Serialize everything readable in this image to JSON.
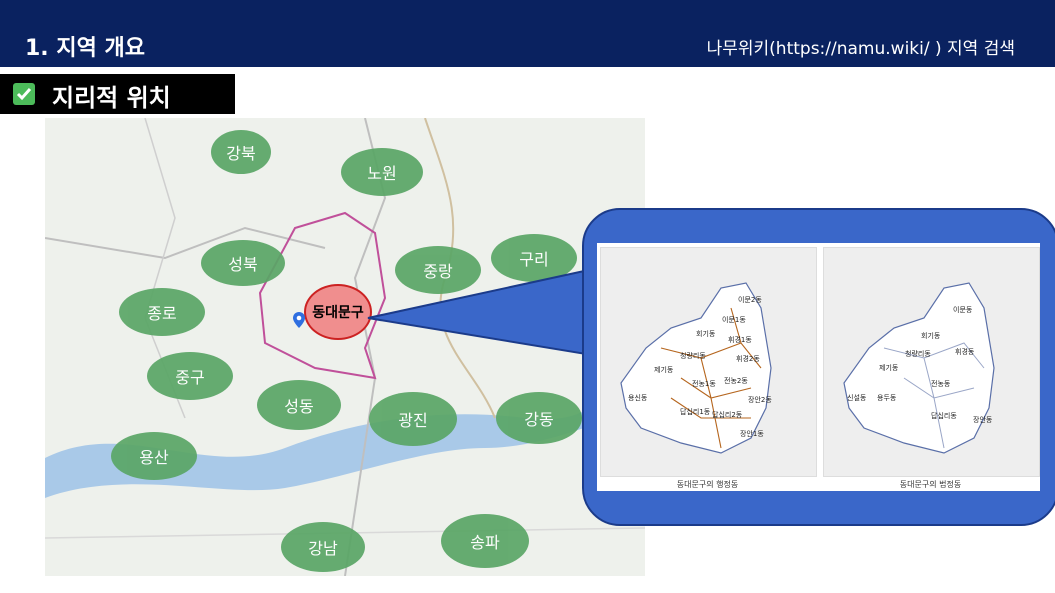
{
  "header": {
    "title": "1. 지역 개요",
    "source": "나무위키(https://namu.wiki/ ) 지역 검색"
  },
  "section": {
    "title": "지리적 위치"
  },
  "map": {
    "districts": {
      "gangbuk": "강북",
      "nowon": "노원",
      "seongbuk": "성북",
      "jungnang": "중랑",
      "guri": "구리",
      "jongno": "종로",
      "jung": "중구",
      "seongdong": "성동",
      "gwangjin": "광진",
      "gangdong": "강동",
      "yongsan": "용산",
      "gangnam": "강남",
      "songpa": "송파"
    },
    "highlight": "동대문구"
  },
  "callout": {
    "left_caption": "동대문구의 행정동",
    "right_caption": "동대문구의 법정동",
    "left_labels": [
      "이문2동",
      "이문1동",
      "회기동",
      "휘경1동",
      "휘경2동",
      "청량리동",
      "제기동",
      "전농1동",
      "전농2동",
      "장안2동",
      "용신동",
      "답십리1동",
      "답십리2동",
      "장안1동"
    ],
    "right_labels": [
      "이문동",
      "회기동",
      "휘경동",
      "청량리동",
      "제기동",
      "전농동",
      "신설동",
      "용두동",
      "답십리동",
      "장안동"
    ]
  },
  "colors": {
    "header_bg": "#0a2260",
    "accent_blue": "#3a67c9",
    "district_green": "#5aa666",
    "highlight_red": "#f08e8e"
  }
}
